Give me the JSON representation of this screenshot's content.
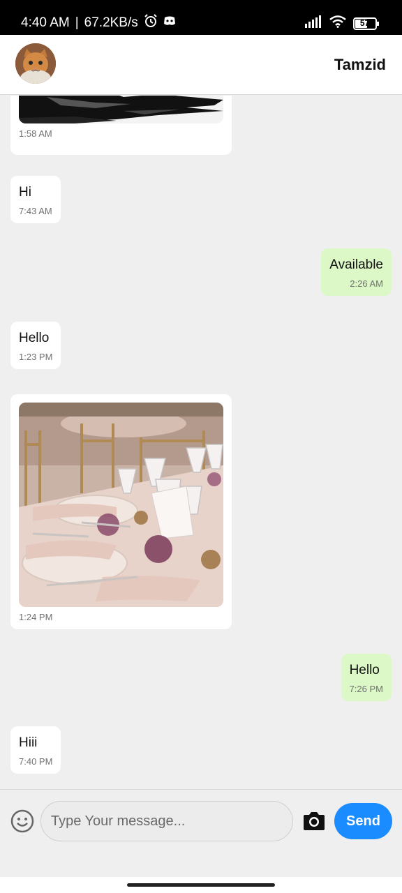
{
  "status_bar": {
    "time": "4:40 AM",
    "separator": "|",
    "speed": "67.2KB/s",
    "battery": "57",
    "icons": [
      "alarm-icon",
      "discord-icon",
      "signal-icon",
      "wifi-icon",
      "battery-icon"
    ]
  },
  "header": {
    "contact_name": "Tamzid",
    "avatar": "cat-avatar"
  },
  "messages": [
    {
      "direction": "in",
      "type": "image",
      "time": "1:58 AM",
      "image": "abstract-brush-strokes"
    },
    {
      "direction": "in",
      "type": "text",
      "text": "Hi",
      "time": "7:43 AM"
    },
    {
      "direction": "out",
      "type": "text",
      "text": "Available",
      "time": "2:26 AM"
    },
    {
      "direction": "in",
      "type": "text",
      "text": "Hello",
      "time": "1:23 PM"
    },
    {
      "direction": "in",
      "type": "image",
      "time": "1:24 PM",
      "image": "banquet-table-setting"
    },
    {
      "direction": "out",
      "type": "text",
      "text": "Hello",
      "time": "7:26 PM"
    },
    {
      "direction": "in",
      "type": "text",
      "text": "Hiii",
      "time": "7:40 PM"
    }
  ],
  "composer": {
    "placeholder": "Type Your message...",
    "value": "",
    "send_label": "Send",
    "emoji_icon": "smiley-icon",
    "camera_icon": "camera-icon"
  },
  "colors": {
    "incoming_bubble": "#ffffff",
    "outgoing_bubble": "#dcf8c6",
    "accent": "#1a8cff",
    "background": "#efefef"
  }
}
